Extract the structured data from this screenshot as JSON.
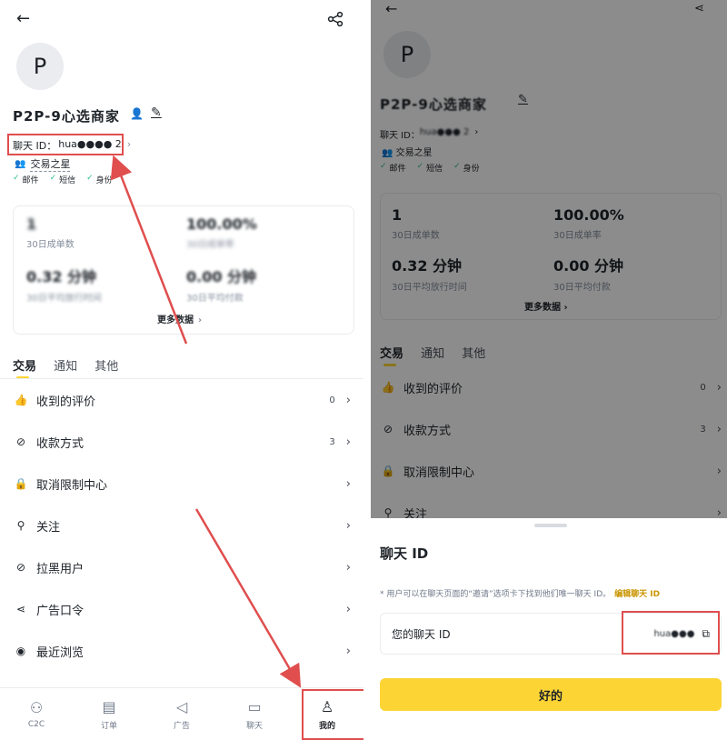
{
  "left": {
    "avatar_letter": "P",
    "name": "P2P-9心选商家",
    "chat_id_label": "聊天 ID：",
    "chat_id_value": "hua●●●● 2",
    "badge": "交易之星",
    "verify": [
      "邮件",
      "短信",
      "身份"
    ],
    "stats": [
      {
        "value": "1",
        "label": "30日成单数"
      },
      {
        "value": "100.00%",
        "label": "30日成单率"
      },
      {
        "value": "0.32 分钟",
        "label": "30日平均放行时间"
      },
      {
        "value": "0.00 分钟",
        "label": "30日平均付款"
      }
    ],
    "more_data": "更多数据",
    "tabs": [
      "交易",
      "通知",
      "其他"
    ],
    "menu": [
      {
        "icon": "thumbs-up-icon",
        "label": "收到的评价",
        "count": "0"
      },
      {
        "icon": "payment-icon",
        "label": "收款方式",
        "count": "3"
      },
      {
        "icon": "lock-icon",
        "label": "取消限制中心",
        "count": ""
      },
      {
        "icon": "follow-icon",
        "label": "关注",
        "count": ""
      },
      {
        "icon": "block-icon",
        "label": "拉黑用户",
        "count": ""
      },
      {
        "icon": "share-icon",
        "label": "广告口令",
        "count": ""
      },
      {
        "icon": "eye-icon",
        "label": "最近浏览",
        "count": ""
      }
    ],
    "nav": [
      {
        "label": "C2C",
        "icon": "users-icon"
      },
      {
        "label": "订单",
        "icon": "order-icon"
      },
      {
        "label": "广告",
        "icon": "megaphone-icon"
      },
      {
        "label": "聊天",
        "icon": "chat-icon"
      },
      {
        "label": "我的",
        "icon": "person-icon"
      }
    ]
  },
  "right": {
    "avatar_letter": "P",
    "name": "P2P-9心选商家",
    "chat_id_label": "聊天 ID：",
    "chat_id_value": "hua●●● 2",
    "badge": "交易之星",
    "verify": [
      "邮件",
      "短信",
      "身份"
    ],
    "stats": [
      {
        "value": "1",
        "label": "30日成单数"
      },
      {
        "value": "100.00%",
        "label": "30日成单率"
      },
      {
        "value": "0.32 分钟",
        "label": "30日平均放行时间"
      },
      {
        "value": "0.00 分钟",
        "label": "30日平均付款"
      }
    ],
    "more_data": "更多数据",
    "tabs": [
      "交易",
      "通知",
      "其他"
    ],
    "menu": [
      {
        "label": "收到的评价",
        "count": "0"
      },
      {
        "label": "收款方式",
        "count": "3"
      },
      {
        "label": "取消限制中心",
        "count": ""
      },
      {
        "label": "关注",
        "count": ""
      }
    ],
    "sheet": {
      "title": "聊天 ID",
      "desc": "* 用户可以在聊天页面的“邀请”选项卡下找到他们唯一聊天 ID。",
      "edit_link": "编辑聊天 ID",
      "field_label": "您的聊天 ID",
      "field_value": "hua●●●",
      "ok_button": "好的"
    }
  },
  "colors": {
    "accent": "#fcd535",
    "success": "#2ebd85",
    "annotation": "#e04e4e"
  }
}
